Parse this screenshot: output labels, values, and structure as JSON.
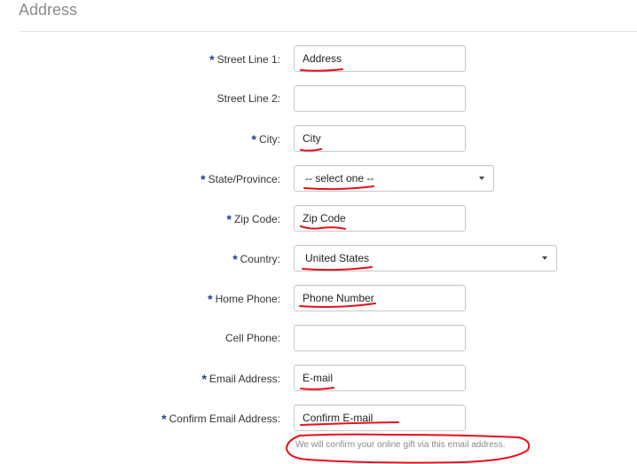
{
  "section": {
    "title": "Address"
  },
  "form": {
    "required_marker": "*",
    "fields": [
      {
        "label": "Street Line 1:",
        "required": true,
        "type": "text",
        "value": "Address"
      },
      {
        "label": "Street Line 2:",
        "required": false,
        "type": "text",
        "value": ""
      },
      {
        "label": "City:",
        "required": true,
        "type": "text",
        "value": "City"
      },
      {
        "label": "State/Province:",
        "required": true,
        "type": "select",
        "value": "-- select one --"
      },
      {
        "label": "Zip Code:",
        "required": true,
        "type": "text",
        "value": "Zip Code"
      },
      {
        "label": "Country:",
        "required": true,
        "type": "select",
        "value": "United States"
      },
      {
        "label": "Home Phone:",
        "required": true,
        "type": "text",
        "value": "Phone Number"
      },
      {
        "label": "Cell Phone:",
        "required": false,
        "type": "text",
        "value": ""
      },
      {
        "label": "Email Address:",
        "required": true,
        "type": "text",
        "value": "E-mail"
      },
      {
        "label": "Confirm Email Address:",
        "required": true,
        "type": "text",
        "value": "Confirm E-mail"
      }
    ],
    "confirm_note": "We will confirm your online gift via this email address."
  },
  "colors": {
    "required_marker": "#1a3f8f",
    "annotation_ink": "#e8101a",
    "section_title": "#8c8c8c"
  }
}
